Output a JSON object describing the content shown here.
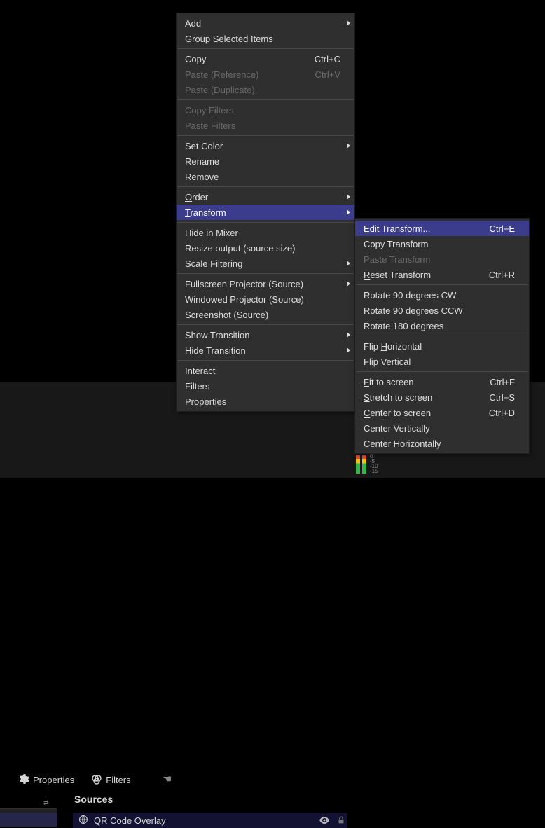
{
  "toolbar": {
    "properties": "Properties",
    "filters": "Filters"
  },
  "sources": {
    "title": "Sources",
    "item_icon": "globe",
    "item_label": "QR Code Overlay"
  },
  "audio": {
    "scale": [
      "0",
      "-5",
      "-10",
      "-15"
    ]
  },
  "context_menu": {
    "add": "Add",
    "group": "Group Selected Items",
    "copy": "Copy",
    "copy_sc": "Ctrl+C",
    "paste_ref": "Paste (Reference)",
    "paste_ref_sc": "Ctrl+V",
    "paste_dup": "Paste (Duplicate)",
    "copy_filters": "Copy Filters",
    "paste_filters": "Paste Filters",
    "set_color": "Set Color",
    "rename": "Rename",
    "remove": "Remove",
    "order": "Order",
    "order_mn": "O",
    "transform": "Transform",
    "transform_mn": "T",
    "hide_mixer": "Hide in Mixer",
    "resize_output": "Resize output (source size)",
    "scale_filtering": "Scale Filtering",
    "fullscreen_proj": "Fullscreen Projector (Source)",
    "windowed_proj": "Windowed Projector (Source)",
    "screenshot": "Screenshot (Source)",
    "show_transition": "Show Transition",
    "hide_transition": "Hide Transition",
    "interact": "Interact",
    "filters": "Filters",
    "properties": "Properties"
  },
  "transform_submenu": {
    "edit": "Edit Transform...",
    "edit_mn": "E",
    "edit_sc": "Ctrl+E",
    "copy": "Copy Transform",
    "paste": "Paste Transform",
    "reset": "Reset Transform",
    "reset_mn": "R",
    "reset_sc": "Ctrl+R",
    "rot_cw": "Rotate 90 degrees CW",
    "rot_ccw": "Rotate 90 degrees CCW",
    "rot_180": "Rotate 180 degrees",
    "flip_h": "Flip Horizontal",
    "flip_h_mn": "H",
    "flip_v": "Flip Vertical",
    "flip_v_mn": "V",
    "fit": "Fit to screen",
    "fit_mn": "F",
    "fit_sc": "Ctrl+F",
    "stretch": "Stretch to screen",
    "stretch_mn": "S",
    "stretch_sc": "Ctrl+S",
    "center": "Center to screen",
    "center_mn": "C",
    "center_sc": "Ctrl+D",
    "center_v": "Center Vertically",
    "center_h": "Center Horizontally"
  }
}
